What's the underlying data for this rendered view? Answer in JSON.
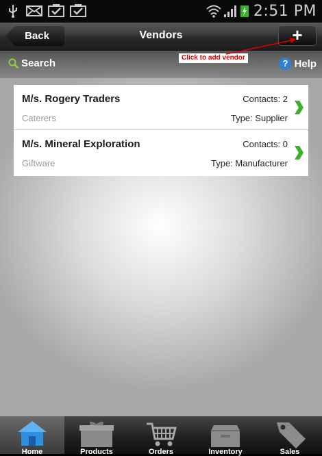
{
  "statusbar": {
    "time": "2:51 PM",
    "icons": [
      "usb-icon",
      "mail-icon",
      "check-icon",
      "check-icon",
      "wifi-icon",
      "signal-icon",
      "battery-charging-icon"
    ]
  },
  "titlebar": {
    "back_label": "Back",
    "title": "Vendors",
    "add_label": "+"
  },
  "annotation": "Click to add vendor",
  "searchbar": {
    "search_label": "Search",
    "help_label": "Help",
    "help_glyph": "?"
  },
  "vendors": [
    {
      "name": "M/s. Rogery Traders",
      "category": "Caterers",
      "contacts": "Contacts: 2",
      "type": "Type: Supplier"
    },
    {
      "name": "M/s. Mineral Exploration",
      "category": "Giftware",
      "contacts": "Contacts: 0",
      "type": "Type: Manufacturer"
    }
  ],
  "tabs": [
    {
      "label": "Home",
      "icon": "home-icon",
      "active": true
    },
    {
      "label": "Products",
      "icon": "gift-box-icon"
    },
    {
      "label": "Orders",
      "icon": "shopping-cart-icon"
    },
    {
      "label": "Inventory",
      "icon": "box-icon"
    },
    {
      "label": "Sales",
      "icon": "tag-icon"
    }
  ],
  "colors": {
    "accent_green": "#3bb02c",
    "annotation_red": "#e00000",
    "help_blue": "#2e7fd6",
    "home_blue": "#2f8fe0"
  }
}
